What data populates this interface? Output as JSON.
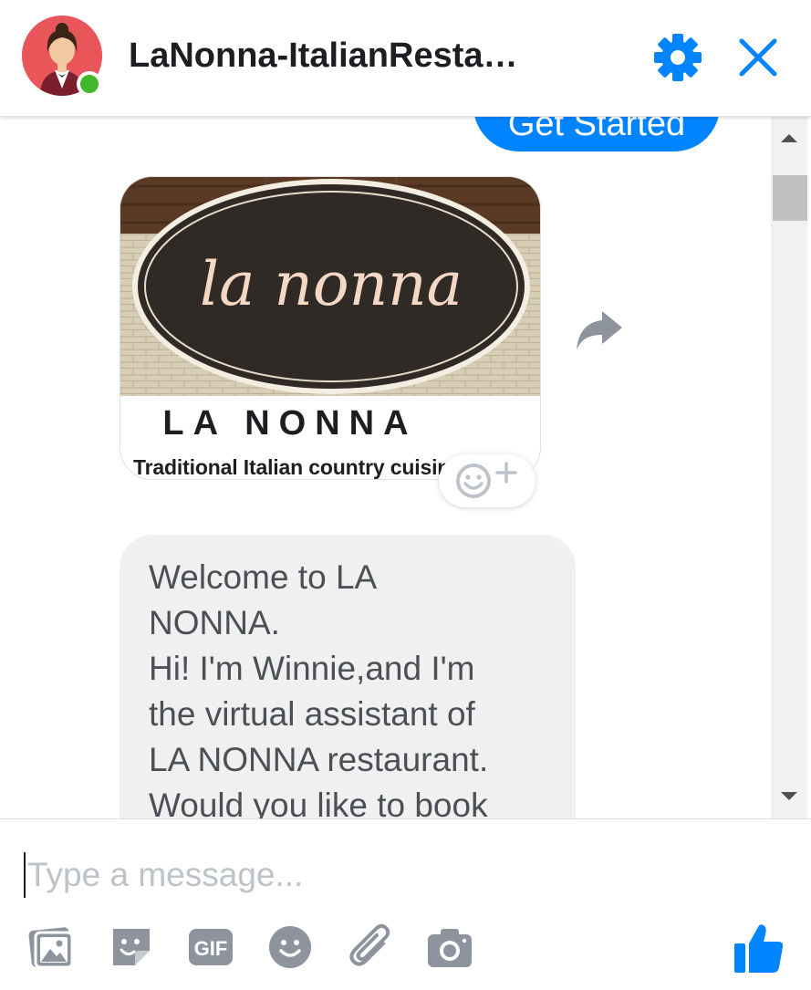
{
  "header": {
    "title": "LaNonna-ItalianResta…",
    "status": "online"
  },
  "quick_reply": {
    "label": "Get Started"
  },
  "card": {
    "sign_text": "la nonna",
    "name": "LA NONNA",
    "tagline": "Traditional Italian country cuisine"
  },
  "message": {
    "lines": [
      "Welcome to LA",
      "NONNA.",
      "Hi! I'm Winnie,and I'm",
      "the virtual assistant of",
      "LA NONNA restaurant.",
      "Would you like to book"
    ]
  },
  "composer": {
    "placeholder": "Type a message...",
    "tools": [
      "photo-icon",
      "sticker-icon",
      "gif-icon",
      "emoji-icon",
      "attachment-icon",
      "camera-icon"
    ],
    "gif_label": "GIF"
  },
  "colors": {
    "accent": "#0084ff",
    "presence": "#42b72a",
    "icon_gray": "#8d949e",
    "bubble": "#f1f0f0"
  }
}
